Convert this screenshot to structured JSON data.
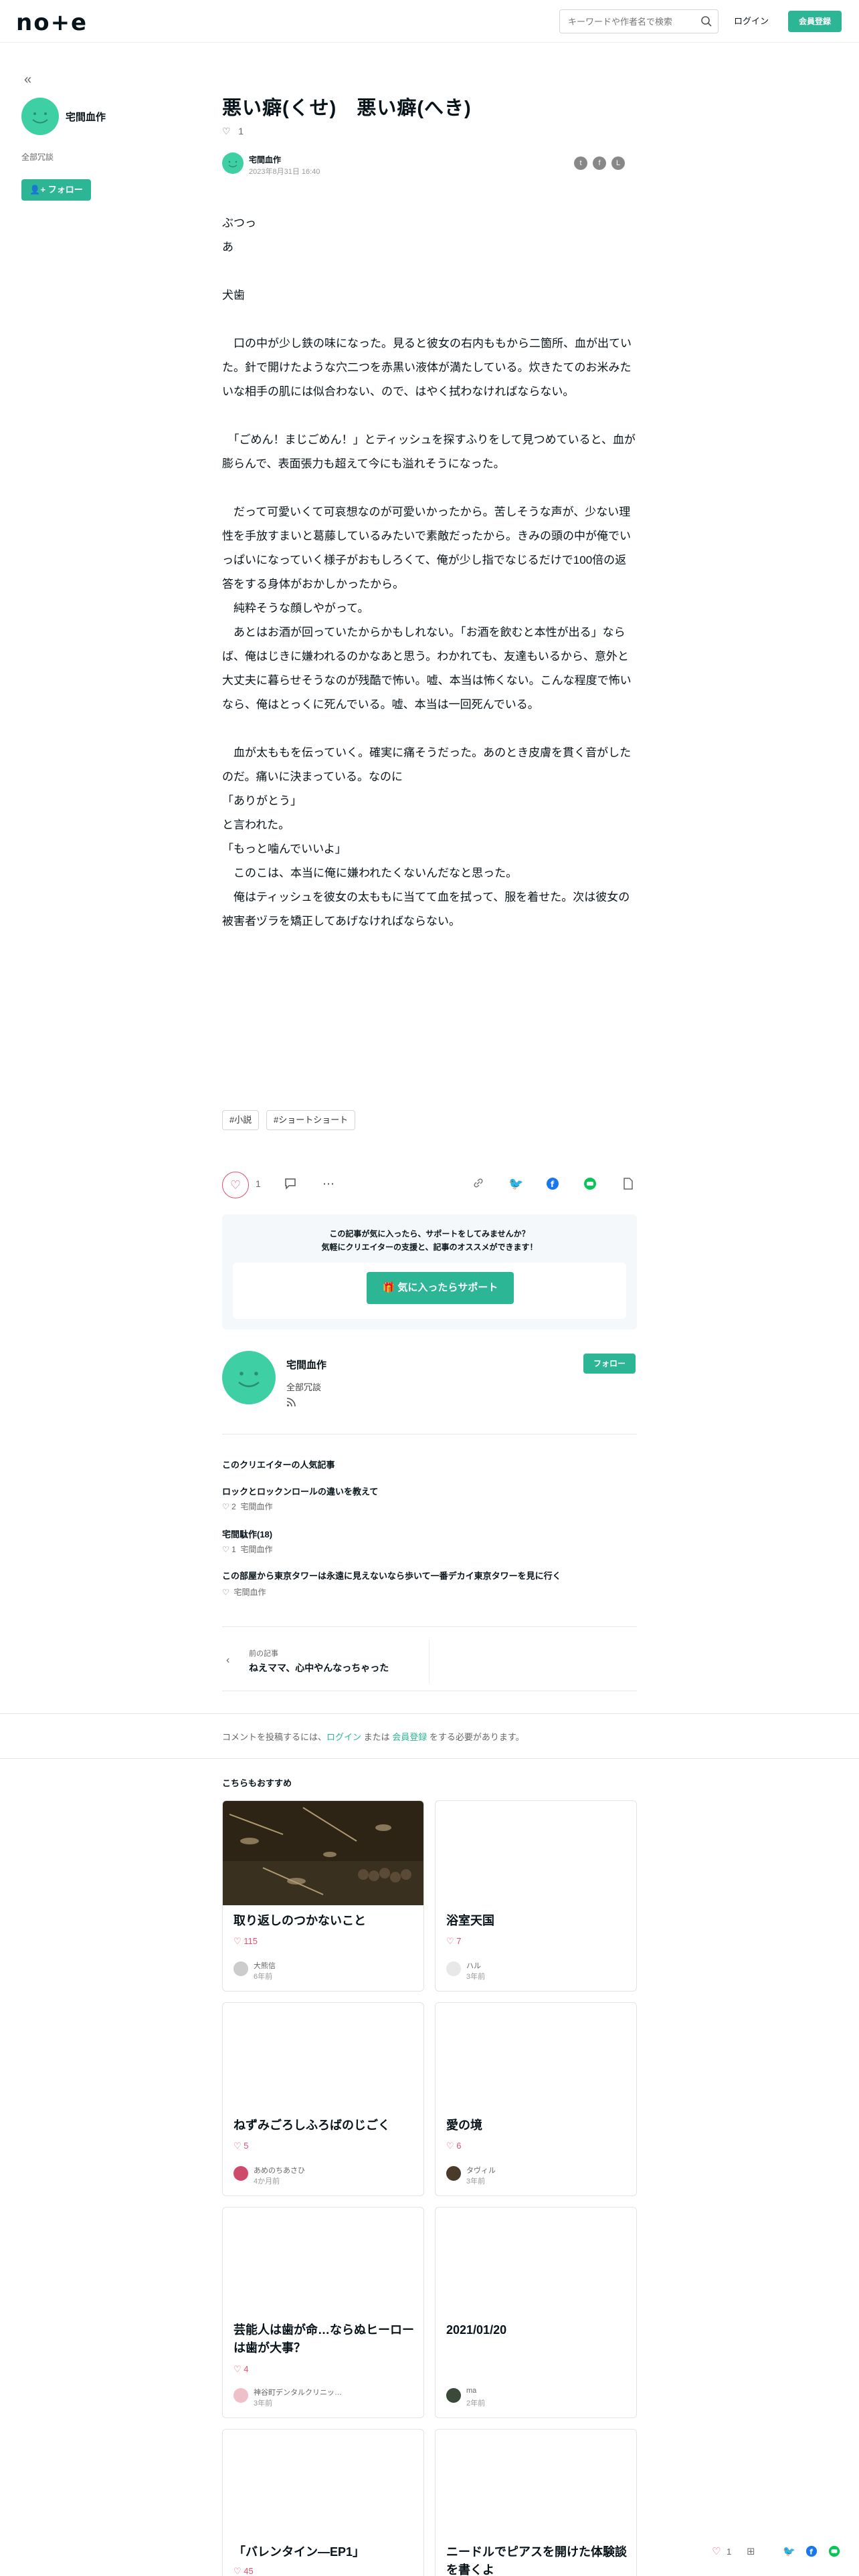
{
  "header": {
    "search_placeholder": "キーワードや作者名で検索",
    "login": "ログイン",
    "signup": "会員登録"
  },
  "sidebar": {
    "name": "宅間血作",
    "bio": "全部冗談",
    "follow": "フォロー"
  },
  "article": {
    "title": "悪い癖(くせ)　悪い癖(へき)",
    "likes": "1",
    "author": "宅間血作",
    "date": "2023年8月31日 16:40",
    "body": [
      "ぶつっ",
      "",
      "あ",
      "",
      "犬歯",
      "",
      "　口の中が少し鉄の味になった。見ると彼女の右内ももから二箇所、血が出ていた。針で開けたような穴二つを赤黒い液体が満たしている。炊きたてのお米みたいな相手の肌には似合わない、ので、はやく拭わなければならない。",
      "",
      "　「ごめん！まじごめん！」とティッシュを探すふりをして見つめていると、血が膨らんで、表面張力も超えて今にも溢れそうになった。",
      "",
      "　だって可愛いくて可哀想なのが可愛いかったから。苦しそうな声が、少ない理性を手放すまいと葛藤しているみたいで素敵だったから。きみの頭の中が俺でいっぱいになっていく様子がおもしろくて、俺が少し指でなじるだけで100倍の返答をする身体がおかしかったから。",
      "　純粋そうな顔しやがって。",
      "　あとはお酒が回っていたからかもしれない。「お酒を飲むと本性が出る」ならば、俺はじきに嫌われるのかなあと思う。わかれても、友達もいるから、意外と大丈夫に暮らせそうなのが残酷で怖い。嘘、本当は怖くない。こんな程度で怖いなら、俺はとっくに死んでいる。嘘、本当は一回死んでいる。",
      "",
      "　血が太ももを伝っていく。確実に痛そうだった。あのとき皮膚を貫く音がしたのだ。痛いに決まっている。なのに",
      "「ありがとう」",
      "と言われた。",
      "「もっと噛んでいいよ」",
      "　このこは、本当に俺に嫌われたくないんだなと思った。",
      "　俺はティッシュを彼女の太ももに当てて血を拭って、服を着せた。次は彼女の被害者ヅラを矯正してあげなければならない。"
    ],
    "tags": [
      "#小説",
      "#ショートショート"
    ],
    "like_count": "1"
  },
  "support": {
    "line1": "この記事が気に入ったら、サポートをしてみませんか？",
    "line2": "気軽にクリエイターの支援と、記事のオススメができます！",
    "button": "気に入ったらサポート"
  },
  "creator": {
    "name": "宅間血作",
    "bio": "全部冗談",
    "follow": "フォロー"
  },
  "popular": {
    "heading": "このクリエイターの人気記事",
    "items": [
      {
        "title": "ロックとロックンロールの違いを教えて",
        "likes": "2",
        "author": "宅間血作"
      },
      {
        "title": "宅間駄作(18)",
        "likes": "1",
        "author": "宅間血作"
      },
      {
        "title": "この部屋から東京タワーは永遠に見えないなら歩いて一番デカイ東京タワーを見に行く",
        "likes": "",
        "author": "宅間血作"
      }
    ]
  },
  "prev": {
    "label": "前の記事",
    "title": "ねえママ、心中やんなっちゃった"
  },
  "comment": {
    "pre": "コメントを投稿するには、",
    "login": "ログイン",
    "mid": " または ",
    "signup": "会員登録",
    "post": " をする必要があります。"
  },
  "recommend": {
    "heading": "こちらもおすすめ",
    "cards": [
      {
        "title": "取り返しのつかないこと",
        "likes": "115",
        "author": "大熊信",
        "ago": "6年前"
      },
      {
        "title": "浴室天国",
        "likes": "7",
        "author": "ハル",
        "ago": "3年前"
      },
      {
        "title": "ねずみごろしふろばのじごく",
        "likes": "5",
        "author": "あめのちあさひ",
        "ago": "4か月前"
      },
      {
        "title": "愛の境",
        "likes": "6",
        "author": "タヴィル",
        "ago": "3年前"
      },
      {
        "title": "芸能人は歯が命…ならぬヒーローは歯が大事？",
        "likes": "4",
        "author": "神谷町デンタルクリニッ…",
        "ago": "3年前"
      },
      {
        "title": "2021/01/20",
        "likes": "",
        "author": "ma",
        "ago": "2年前"
      },
      {
        "title": "「バレンタイン―EP1」",
        "likes": "45",
        "author": "",
        "ago": ""
      },
      {
        "title": "ニードルでピアスを開けた体験談を書くよ",
        "likes": "",
        "author": "",
        "ago": ""
      }
    ]
  },
  "floating": {
    "likes": "1"
  },
  "colors": {
    "accent": "#2cb696",
    "like": "#e15070"
  }
}
